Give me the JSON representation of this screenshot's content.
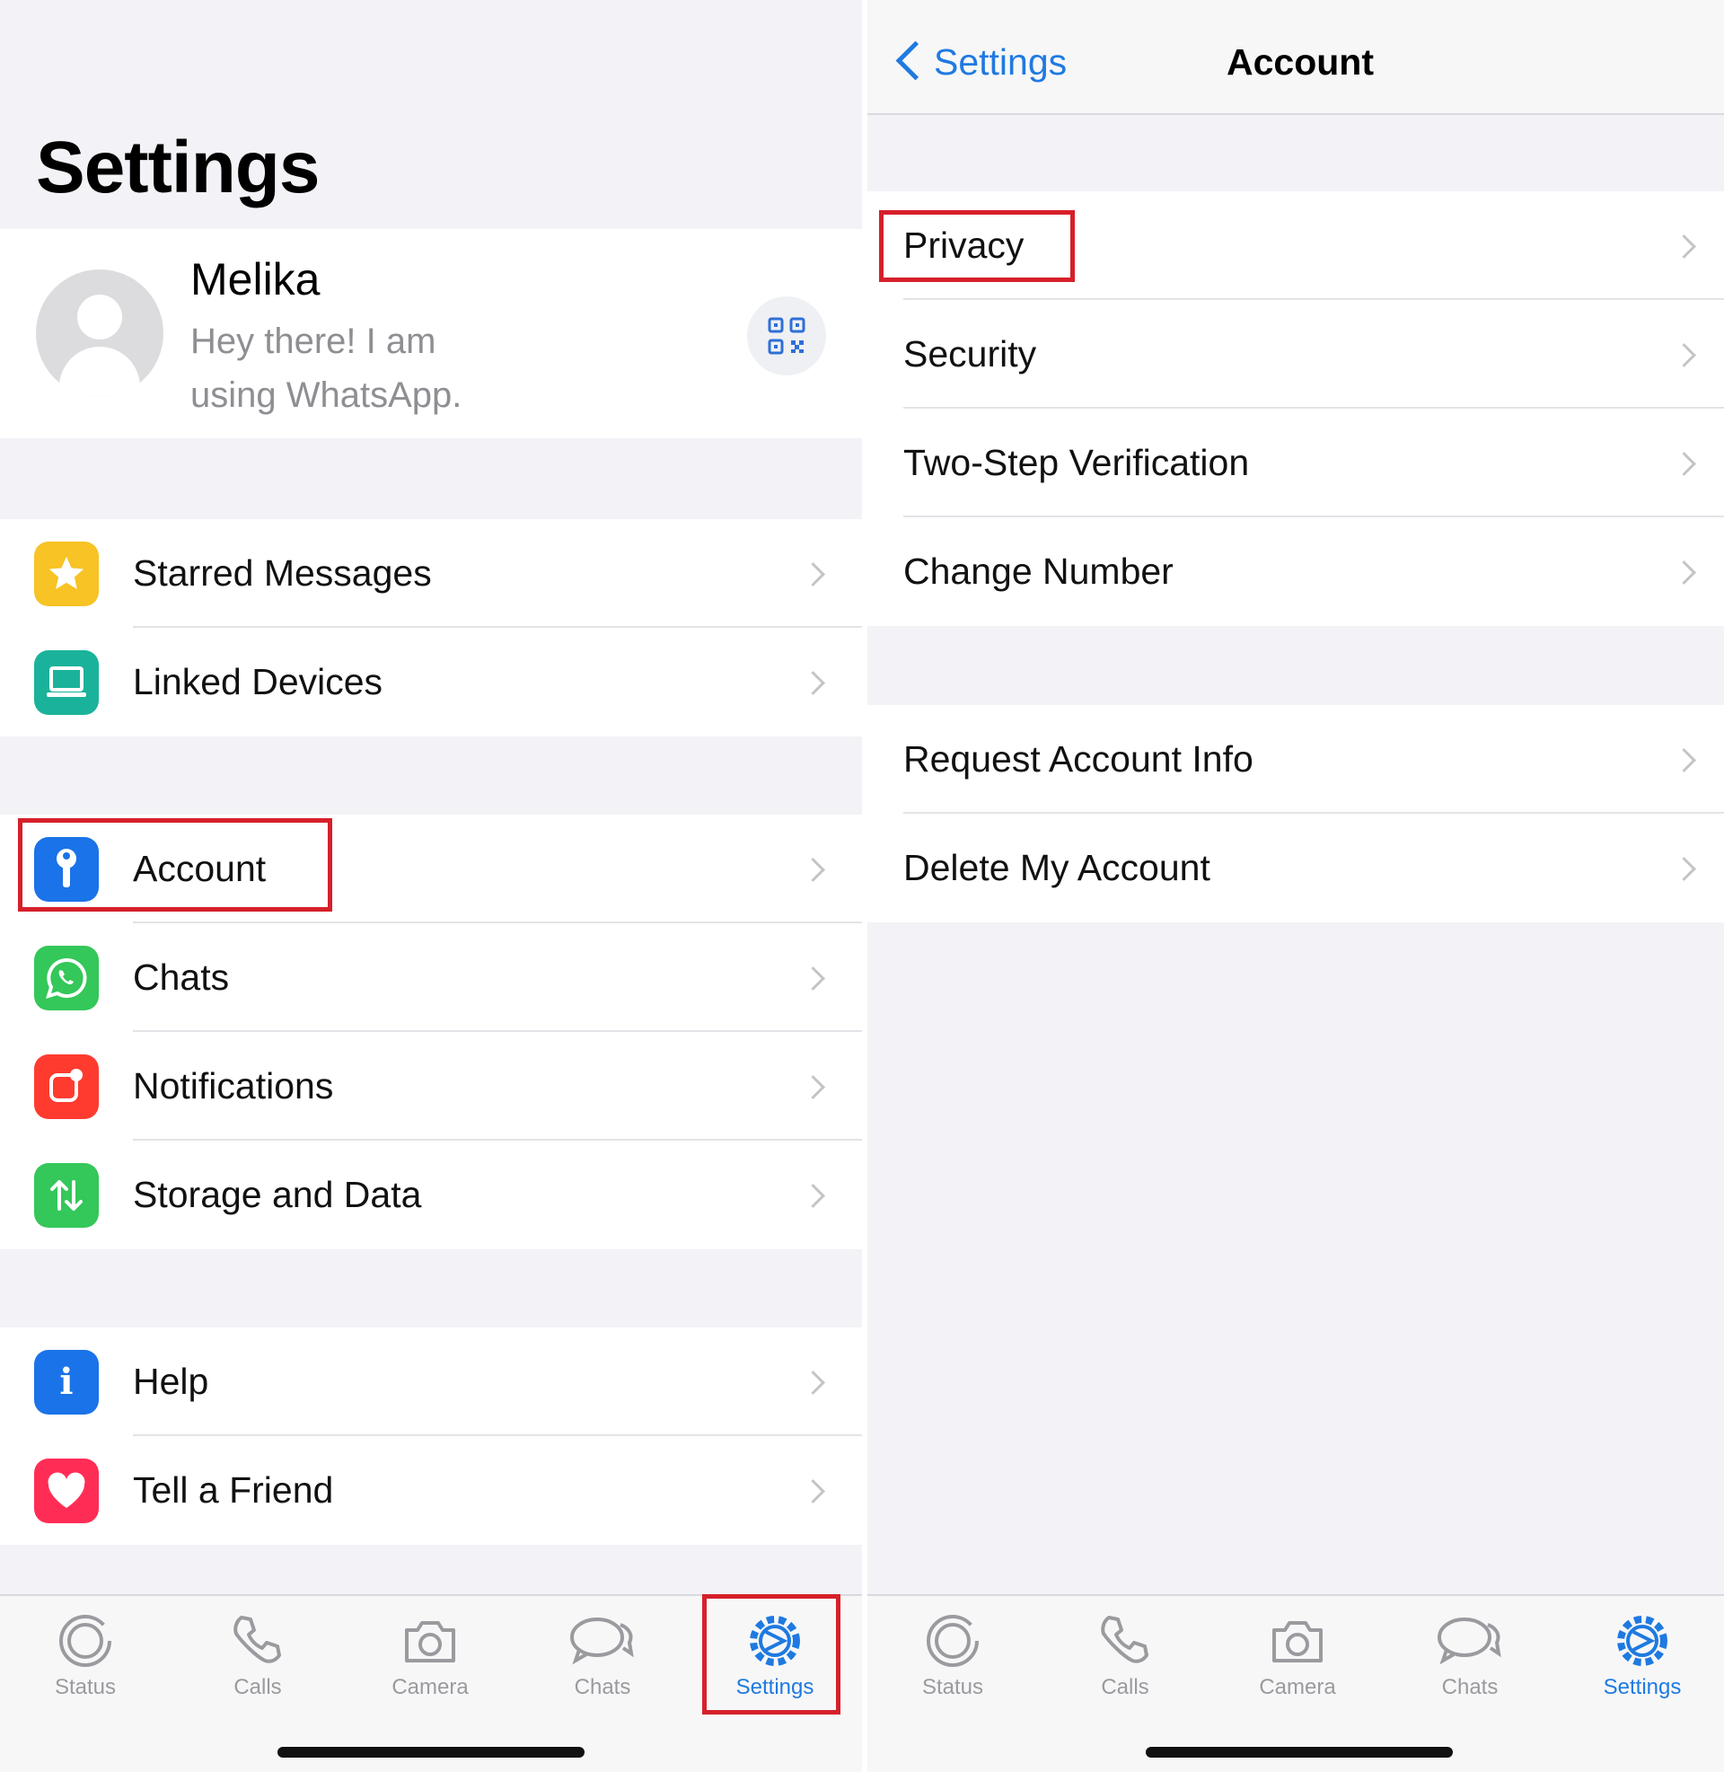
{
  "left": {
    "title": "Settings",
    "profile": {
      "name": "Melika",
      "status_line1": "Hey there! I am",
      "status_line2": "using WhatsApp."
    },
    "groups": [
      {
        "items": [
          {
            "label": "Starred Messages",
            "icon": "star-icon",
            "color": "#f7c325"
          },
          {
            "label": "Linked Devices",
            "icon": "laptop-icon",
            "color": "#1ab29a"
          }
        ]
      },
      {
        "items": [
          {
            "label": "Account",
            "icon": "key-icon",
            "color": "#1a73e8"
          },
          {
            "label": "Chats",
            "icon": "whatsapp-icon",
            "color": "#34c759"
          },
          {
            "label": "Notifications",
            "icon": "notification-icon",
            "color": "#ff3b30"
          },
          {
            "label": "Storage and Data",
            "icon": "storage-arrows-icon",
            "color": "#34c759"
          }
        ]
      },
      {
        "items": [
          {
            "label": "Help",
            "icon": "info-icon",
            "color": "#1a73e8"
          },
          {
            "label": "Tell a Friend",
            "icon": "heart-icon",
            "color": "#ff2d55"
          }
        ]
      }
    ]
  },
  "right": {
    "back_label": "Settings",
    "title": "Account",
    "groups": [
      {
        "items": [
          {
            "label": "Privacy"
          },
          {
            "label": "Security"
          },
          {
            "label": "Two-Step Verification"
          },
          {
            "label": "Change Number"
          }
        ]
      },
      {
        "items": [
          {
            "label": "Request Account Info"
          },
          {
            "label": "Delete My Account"
          }
        ]
      }
    ]
  },
  "tabbar": {
    "tabs": [
      {
        "label": "Status",
        "icon": "status-icon"
      },
      {
        "label": "Calls",
        "icon": "phone-icon"
      },
      {
        "label": "Camera",
        "icon": "camera-icon"
      },
      {
        "label": "Chats",
        "icon": "chat-bubbles-icon"
      },
      {
        "label": "Settings",
        "icon": "settings-gear-icon",
        "active": true
      }
    ],
    "active_color": "#1f7ae0",
    "inactive_color": "#9a9a9f"
  },
  "highlight_color": "#d6202a"
}
